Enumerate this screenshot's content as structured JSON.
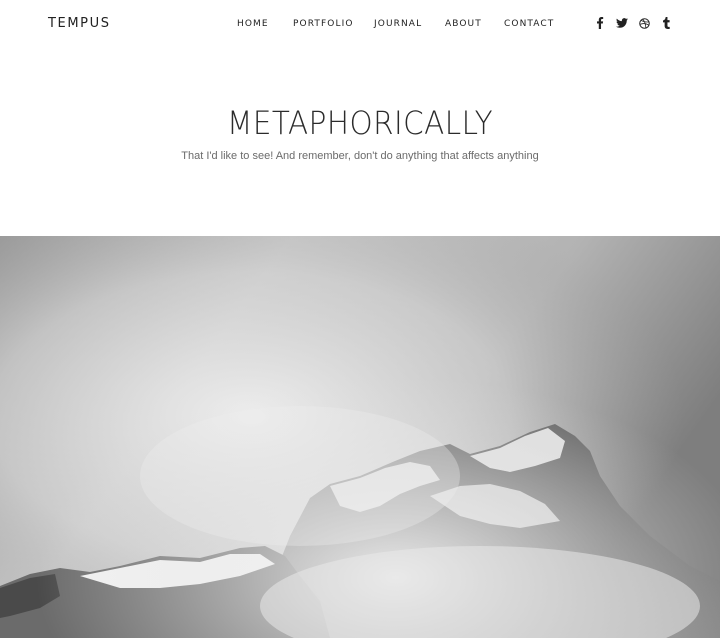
{
  "header": {
    "logo": "TEMPUS",
    "nav": [
      {
        "label": "HOME"
      },
      {
        "label": "PORTFOLIO"
      },
      {
        "label": "JOURNAL"
      },
      {
        "label": "ABOUT"
      },
      {
        "label": "CONTACT"
      }
    ],
    "social": [
      {
        "icon": "facebook-icon"
      },
      {
        "icon": "twitter-icon"
      },
      {
        "icon": "dribbble-icon"
      },
      {
        "icon": "tumblr-icon"
      }
    ]
  },
  "hero": {
    "title": "METAPHORICALLY",
    "subtitle": "That I'd like to see! And remember, don't do anything that affects anything"
  },
  "colors": {
    "text": "#222222",
    "subtitle": "#6b6b6b",
    "background": "#ffffff"
  }
}
